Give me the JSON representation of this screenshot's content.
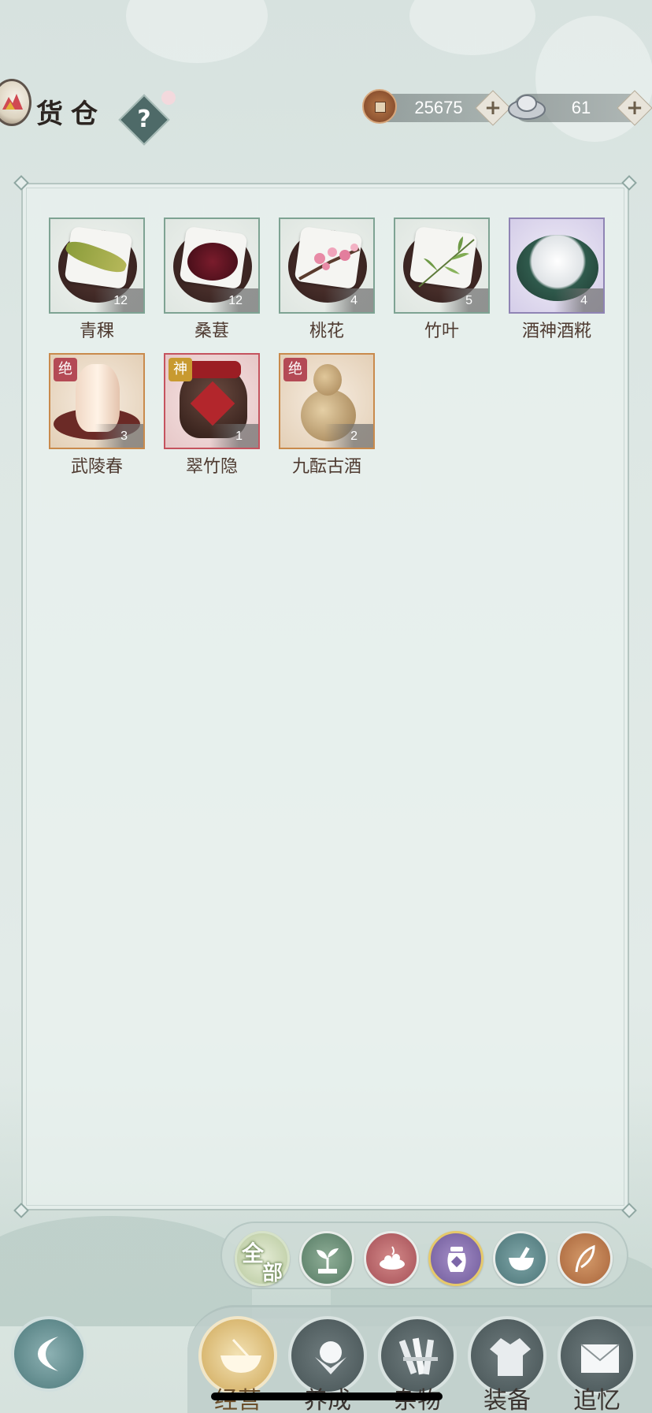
{
  "header": {
    "title": "货仓",
    "help_label": "?",
    "copper": {
      "value": "25675",
      "plus": "+"
    },
    "silver": {
      "value": "61",
      "plus": "+"
    }
  },
  "items": [
    {
      "name": "青稞",
      "count": "12",
      "rarity": "green"
    },
    {
      "name": "桑葚",
      "count": "12",
      "rarity": "green"
    },
    {
      "name": "桃花",
      "count": "4",
      "rarity": "green"
    },
    {
      "name": "竹叶",
      "count": "5",
      "rarity": "green"
    },
    {
      "name": "酒神酒糀",
      "count": "4",
      "rarity": "purple"
    },
    {
      "name": "武陵春",
      "count": "3",
      "rarity": "gold",
      "badge": "绝"
    },
    {
      "name": "翠竹隐",
      "count": "1",
      "rarity": "red",
      "badge": "神"
    },
    {
      "name": "九酝古酒",
      "count": "2",
      "rarity": "gold",
      "badge": "绝"
    }
  ],
  "filters": {
    "all_label_1": "全",
    "all_label_2": "部",
    "icons": [
      "sprout-icon",
      "food-plate-icon",
      "wine-jar-icon",
      "mortar-icon",
      "feather-icon"
    ]
  },
  "nav": [
    {
      "label": "经营",
      "icon": "bowl-icon"
    },
    {
      "label": "养成",
      "icon": "pearl-icon"
    },
    {
      "label": "杂物",
      "icon": "bundle-icon"
    },
    {
      "label": "装备",
      "icon": "robe-icon"
    },
    {
      "label": "追忆",
      "icon": "letter-icon"
    }
  ],
  "colors": {
    "accent_green": "#7ea393",
    "rarity_purple": "#8f84b4",
    "rarity_gold": "#c98a4c",
    "rarity_red": "#c5535e"
  }
}
